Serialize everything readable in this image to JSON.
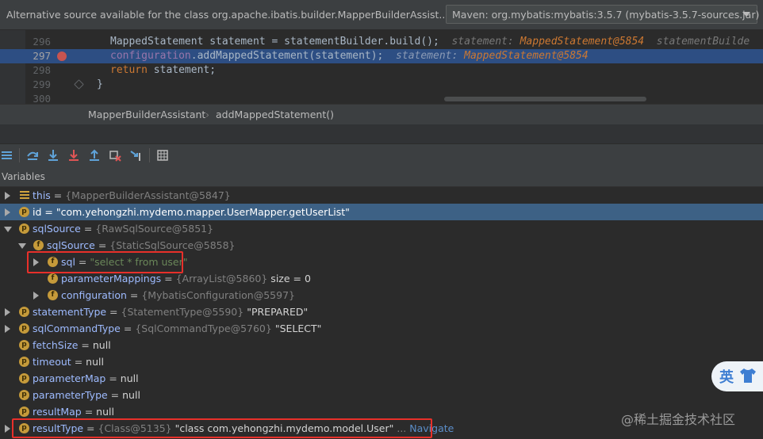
{
  "banner": {
    "text": "Alternative source available for the class org.apache.ibatis.builder.MapperBuilderAssist...",
    "source_select": "Maven: org.mybatis:mybatis:3.5.7 (mybatis-3.5.7-sources.jar)"
  },
  "editor": {
    "lines": [
      {
        "num": "296",
        "pre": "MappedStatement statement = statementBuilder.build();",
        "hint_label": "statement:",
        "hint_value": "MappedStatement@5854",
        "hint_tail": "statementBuilde"
      },
      {
        "num": "297",
        "pre": "configuration",
        "method": ".addMappedStatement(statement);",
        "hint_label": "statement:",
        "hint_value": "MappedStatement@5854"
      },
      {
        "num": "298",
        "keyword": "return",
        "rest": " statement;"
      },
      {
        "num": "299",
        "rest": "}"
      },
      {
        "num": "300",
        "rest": ""
      }
    ]
  },
  "breadcrumb": {
    "class_name": "MapperBuilderAssistant",
    "separator": "›",
    "method": "addMappedStatement()"
  },
  "variables": {
    "title": "Variables",
    "rows": [
      {
        "name": "this",
        "eq": " = ",
        "ref": "{MapperBuilderAssistant@5847}"
      },
      {
        "badge": "p",
        "name": "id",
        "eq": " = ",
        "str": "\"com.yehongzhi.mydemo.mapper.UserMapper.getUserList\""
      },
      {
        "badge": "p",
        "name": "sqlSource",
        "eq": " = ",
        "ref": "{RawSqlSource@5851}"
      },
      {
        "badge": "f",
        "name": "sqlSource",
        "eq": " = ",
        "ref": "{StaticSqlSource@5858}"
      },
      {
        "badge": "f",
        "name": "sql",
        "eq": " = ",
        "str": "\"select * from user\""
      },
      {
        "badge": "f",
        "name": "parameterMappings",
        "eq": " = ",
        "ref": "{ArrayList@5860}",
        "val": "  size = 0"
      },
      {
        "badge": "f",
        "name": "configuration",
        "eq": " = ",
        "ref": "{MybatisConfiguration@5597}"
      },
      {
        "badge": "p",
        "name": "statementType",
        "eq": " = ",
        "ref": "{StatementType@5590}",
        "val": " \"PREPARED\""
      },
      {
        "badge": "p",
        "name": "sqlCommandType",
        "eq": " = ",
        "ref": "{SqlCommandType@5760}",
        "val": " \"SELECT\""
      },
      {
        "badge": "p",
        "name": "fetchSize",
        "eq": " = ",
        "val": "null"
      },
      {
        "badge": "p",
        "name": "timeout",
        "eq": " = ",
        "val": "null"
      },
      {
        "badge": "p",
        "name": "parameterMap",
        "eq": " = ",
        "val": "null"
      },
      {
        "badge": "p",
        "name": "parameterType",
        "eq": " = ",
        "val": "null"
      },
      {
        "badge": "p",
        "name": "resultMap",
        "eq": " = ",
        "val": "null"
      },
      {
        "badge": "p",
        "name": "resultType",
        "eq": " = ",
        "ref": "{Class@5135}",
        "val": " \"class com.yehongzhi.mydemo.model.User\"",
        "ellipsis": " ... ",
        "nav": "Navigate"
      }
    ]
  },
  "overlay": {
    "ying": "英",
    "watermark": "@稀土掘金技术社区"
  },
  "colors": {
    "selection": "#2d4e83",
    "highlight_box": "#e8302a",
    "badge": "#c59a3a"
  }
}
